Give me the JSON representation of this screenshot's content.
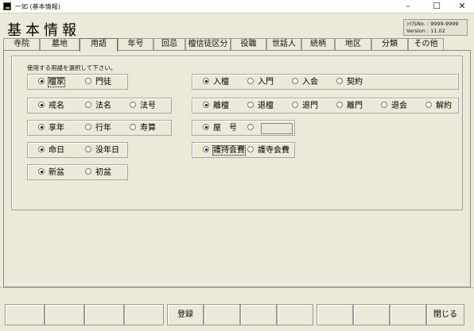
{
  "window": {
    "title": "一如 (基本情報)",
    "min_icon": "–",
    "max_icon": "☐",
    "close_icon": "✕"
  },
  "header": {
    "title": "基本情報",
    "serial": "ｼﾘｱﾙNo. : 9999-9999",
    "version": "Version : 11.02"
  },
  "tabs": [
    "寺院",
    "墓地",
    "用語",
    "年号",
    "回忌",
    "檀信徒区分",
    "役職",
    "世話人",
    "続柄",
    "地区",
    "分類",
    "その他"
  ],
  "active_tab": "用語",
  "panel": {
    "caption": "使用する用語を選択して下さい。",
    "left_rows": [
      {
        "options": [
          "檀家",
          "門徒"
        ],
        "selected": 0
      },
      {
        "options": [
          "戒名",
          "法名",
          "法号"
        ],
        "selected": 0
      },
      {
        "options": [
          "享年",
          "行年",
          "寿算"
        ],
        "selected": 0
      },
      {
        "options": [
          "命日",
          "没年日"
        ],
        "selected": 0
      },
      {
        "options": [
          "新盆",
          "初盆"
        ],
        "selected": 0
      }
    ],
    "right_rows": [
      {
        "options": [
          "入檀",
          "入門",
          "入会",
          "契約"
        ],
        "selected": 0
      },
      {
        "options": [
          "離檀",
          "退檀",
          "退門",
          "離門",
          "退会",
          "解約"
        ],
        "selected": 0
      },
      {
        "options": [
          "屋　号",
          ""
        ],
        "selected": 0,
        "custom_value": ""
      },
      {
        "options": [
          "護持会費",
          "護寺会費"
        ],
        "selected": 0
      }
    ]
  },
  "footer": {
    "buttons": [
      "",
      "",
      "",
      "",
      "登録",
      "",
      "",
      "",
      "",
      "",
      "閉じる"
    ]
  }
}
